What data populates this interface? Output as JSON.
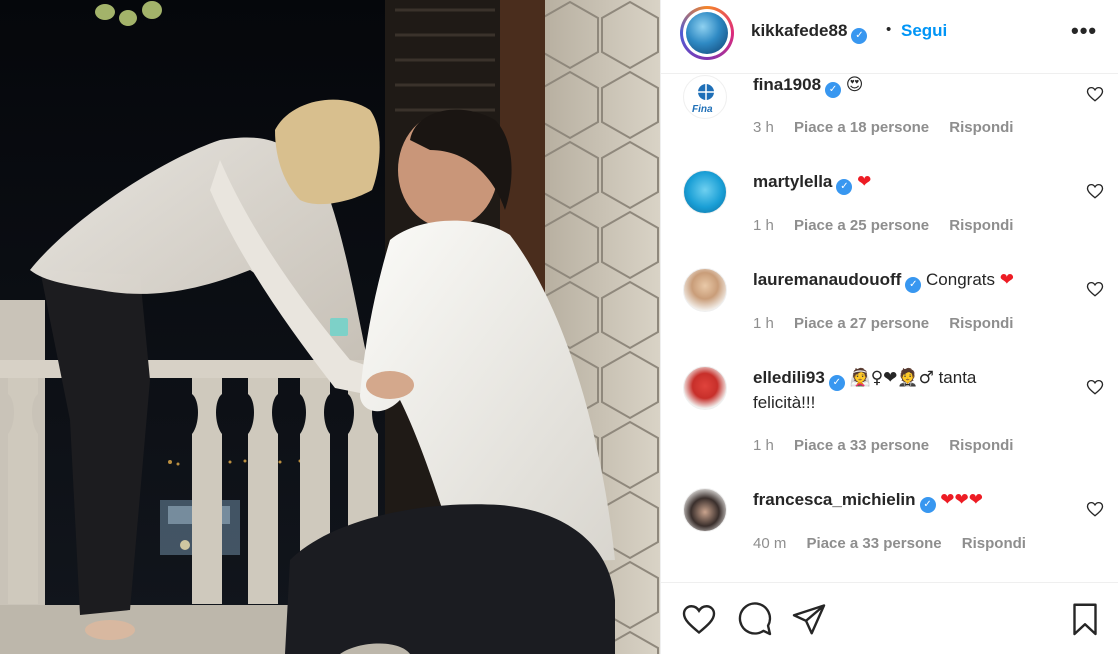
{
  "post": {
    "username": "kikkafede88",
    "follow_label": "Segui",
    "separator": "•",
    "more_label": "•••"
  },
  "comments": [
    {
      "user": "fina1908",
      "text": "",
      "emoji": "😍",
      "time": "3 h",
      "likes": "Piace a 18 persone",
      "reply": "Rispondi"
    },
    {
      "user": "martylella",
      "text": "",
      "emoji": "❤",
      "time": "1 h",
      "likes": "Piace a 25 persone",
      "reply": "Rispondi"
    },
    {
      "user": "lauremanaudouoff",
      "text": "Congrats",
      "emoji": "❤",
      "time": "1 h",
      "likes": "Piace a 27 persone",
      "reply": "Rispondi"
    },
    {
      "user": "elledili93",
      "text": "tanta felicità!!!",
      "emoji": "👰♀❤🤵♂",
      "time": "1 h",
      "likes": "Piace a 33 persone",
      "reply": "Rispondi"
    },
    {
      "user": "francesca_michielin",
      "text": "",
      "emoji": "❤❤❤",
      "time": "40 m",
      "likes": "Piace a 33 persone",
      "reply": "Rispondi"
    }
  ],
  "colors": {
    "accent": "#0095f6",
    "verified": "#3897f0",
    "heart": "#ed1c24",
    "muted": "#8e8e8e"
  },
  "icons": [
    "verified-badge-icon",
    "heart-icon",
    "comment-icon",
    "share-icon",
    "bookmark-icon",
    "more-icon"
  ]
}
